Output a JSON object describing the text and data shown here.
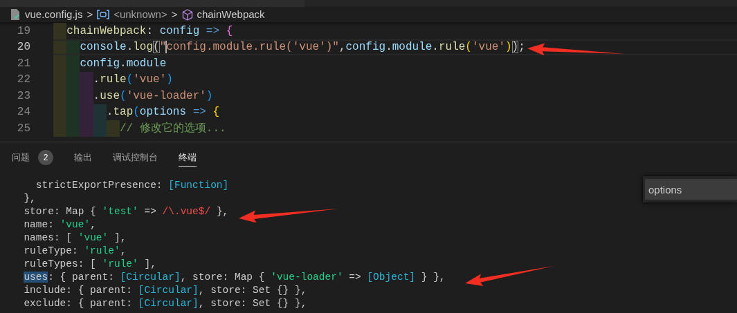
{
  "breadcrumb": {
    "file": "vue.config.js",
    "items": [
      {
        "kind": "separator",
        "text": ">"
      },
      {
        "kind": "variable",
        "text": "<unknown>"
      },
      {
        "kind": "separator",
        "text": ">"
      },
      {
        "kind": "method",
        "text": "chainWebpack"
      }
    ]
  },
  "editor": {
    "lines": [
      {
        "number": "19",
        "current": false,
        "tokens": [
          {
            "kind": "fn",
            "text": "  chainWebpack"
          },
          {
            "kind": "plain",
            "text": ": "
          },
          {
            "kind": "var",
            "text": "config"
          },
          {
            "kind": "keyword",
            "text": " => "
          },
          {
            "kind": "bracket2",
            "text": "{"
          }
        ]
      },
      {
        "number": "20",
        "current": true,
        "tokens": [
          {
            "kind": "var",
            "text": "    console"
          },
          {
            "kind": "plain",
            "text": "."
          },
          {
            "kind": "fn",
            "text": "log"
          },
          {
            "kind": "match",
            "text": "("
          },
          {
            "kind": "str",
            "text": "\"",
            "cursor": true
          },
          {
            "kind": "str",
            "text": "config.module.rule('vue')\""
          },
          {
            "kind": "plain",
            "text": ","
          },
          {
            "kind": "var",
            "text": "config"
          },
          {
            "kind": "plain",
            "text": "."
          },
          {
            "kind": "var",
            "text": "module"
          },
          {
            "kind": "plain",
            "text": "."
          },
          {
            "kind": "fn",
            "text": "rule"
          },
          {
            "kind": "bracket1",
            "text": "("
          },
          {
            "kind": "str",
            "text": "'vue'"
          },
          {
            "kind": "bracket1",
            "text": ")"
          },
          {
            "kind": "match",
            "text": ")"
          },
          {
            "kind": "plain",
            "text": ";"
          }
        ]
      },
      {
        "number": "21",
        "current": false,
        "tokens": [
          {
            "kind": "var",
            "text": "    config"
          },
          {
            "kind": "plain",
            "text": "."
          },
          {
            "kind": "var",
            "text": "module"
          }
        ]
      },
      {
        "number": "22",
        "current": false,
        "tokens": [
          {
            "kind": "plain",
            "text": "      ."
          },
          {
            "kind": "fn",
            "text": "rule"
          },
          {
            "kind": "bracket3",
            "text": "("
          },
          {
            "kind": "str",
            "text": "'vue'"
          },
          {
            "kind": "bracket3",
            "text": ")"
          }
        ]
      },
      {
        "number": "23",
        "current": false,
        "tokens": [
          {
            "kind": "plain",
            "text": "      ."
          },
          {
            "kind": "fn",
            "text": "use"
          },
          {
            "kind": "bracket3",
            "text": "("
          },
          {
            "kind": "str",
            "text": "'vue-loader'"
          },
          {
            "kind": "bracket3",
            "text": ")"
          }
        ]
      },
      {
        "number": "24",
        "current": false,
        "tokens": [
          {
            "kind": "plain",
            "text": "        ."
          },
          {
            "kind": "fn",
            "text": "tap"
          },
          {
            "kind": "bracket3",
            "text": "("
          },
          {
            "kind": "var",
            "text": "options"
          },
          {
            "kind": "keyword",
            "text": " => "
          },
          {
            "kind": "bracket1",
            "text": "{"
          }
        ]
      },
      {
        "number": "25",
        "current": false,
        "tokens": [
          {
            "kind": "comment",
            "text": "          // 修改它的选项..."
          }
        ]
      }
    ]
  },
  "panel": {
    "tabs": [
      {
        "label": "问题",
        "badge": "2",
        "selected": false
      },
      {
        "label": "输出",
        "selected": false
      },
      {
        "label": "调试控制台",
        "selected": false
      },
      {
        "label": "终端",
        "selected": true
      }
    ],
    "find": {
      "value": "options"
    },
    "terminal": [
      {
        "tokens": [
          {
            "kind": "plain",
            "text": "    strictExportPresence: "
          },
          {
            "kind": "special",
            "text": "[Function]"
          }
        ]
      },
      {
        "tokens": [
          {
            "kind": "plain",
            "text": "  },"
          }
        ]
      },
      {
        "tokens": [
          {
            "kind": "plain",
            "text": "  store: Map { "
          },
          {
            "kind": "str",
            "text": "'test'"
          },
          {
            "kind": "plain",
            "text": " => "
          },
          {
            "kind": "regex",
            "text": "/\\.vue$/"
          },
          {
            "kind": "plain",
            "text": " },"
          }
        ]
      },
      {
        "tokens": [
          {
            "kind": "plain",
            "text": "  name: "
          },
          {
            "kind": "str",
            "text": "'vue'"
          },
          {
            "kind": "plain",
            "text": ","
          }
        ]
      },
      {
        "tokens": [
          {
            "kind": "plain",
            "text": "  names: [ "
          },
          {
            "kind": "str",
            "text": "'vue'"
          },
          {
            "kind": "plain",
            "text": " ],"
          }
        ]
      },
      {
        "tokens": [
          {
            "kind": "plain",
            "text": "  ruleType: "
          },
          {
            "kind": "str",
            "text": "'rule'"
          },
          {
            "kind": "plain",
            "text": ","
          }
        ]
      },
      {
        "tokens": [
          {
            "kind": "plain",
            "text": "  ruleTypes: [ "
          },
          {
            "kind": "str",
            "text": "'rule'"
          },
          {
            "kind": "plain",
            "text": " ],"
          }
        ]
      },
      {
        "tokens": [
          {
            "kind": "selection",
            "text": "  uses"
          },
          {
            "kind": "plain",
            "text": ": { parent: "
          },
          {
            "kind": "special",
            "text": "[Circular]"
          },
          {
            "kind": "plain",
            "text": ", store: Map { "
          },
          {
            "kind": "str",
            "text": "'vue-loader'"
          },
          {
            "kind": "plain",
            "text": " => "
          },
          {
            "kind": "special",
            "text": "[Object]"
          },
          {
            "kind": "plain",
            "text": " } },"
          }
        ]
      },
      {
        "tokens": [
          {
            "kind": "plain",
            "text": "  include: { parent: "
          },
          {
            "kind": "special",
            "text": "[Circular]"
          },
          {
            "kind": "plain",
            "text": ", store: Set {} },"
          }
        ]
      },
      {
        "tokens": [
          {
            "kind": "plain",
            "text": "  exclude: { parent: "
          },
          {
            "kind": "special",
            "text": "[Circular]"
          },
          {
            "kind": "plain",
            "text": ", store: Set {} },"
          }
        ]
      }
    ]
  }
}
